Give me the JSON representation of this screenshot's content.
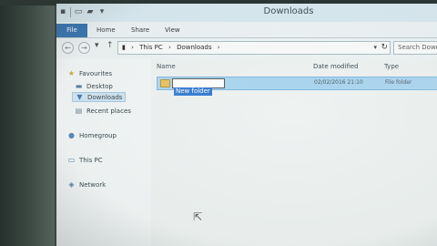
{
  "window": {
    "title": "Downloads"
  },
  "ribbon": {
    "tabs": [
      {
        "label": "File"
      },
      {
        "label": "Home"
      },
      {
        "label": "Share"
      },
      {
        "label": "View"
      }
    ]
  },
  "address": {
    "crumbs": [
      "This PC",
      "Downloads"
    ],
    "search_placeholder": "Search Downl"
  },
  "nav": {
    "favourites": "Favourites",
    "desktop": "Desktop",
    "downloads": "Downloads",
    "recent": "Recent places",
    "homegroup": "Homegroup",
    "thispc": "This PC",
    "network": "Network"
  },
  "columns": {
    "name": "Name",
    "date_modified": "Date modified",
    "type": "Type"
  },
  "files": [
    {
      "name": "New folder",
      "date": "02/02/2016 21:10",
      "type": "File folder"
    }
  ],
  "colors": {
    "file_tab": "#1b5fa6",
    "selection": "#a9d4ef",
    "rename_highlight": "#2f77d0"
  }
}
